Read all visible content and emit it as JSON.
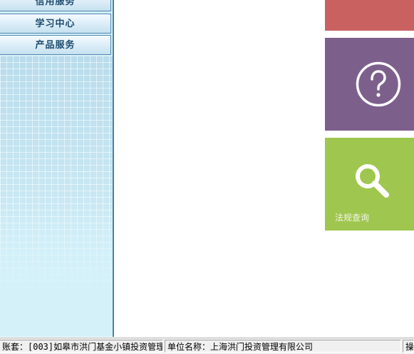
{
  "sidebar": {
    "items": [
      {
        "label": "信用服务"
      },
      {
        "label": "学习中心"
      },
      {
        "label": "产品服务"
      }
    ]
  },
  "tiles": {
    "help": {
      "icon": "question-icon"
    },
    "search": {
      "icon": "search-icon",
      "label": "法规查询"
    }
  },
  "statusbar": {
    "account": "账套：[003]如皋市洪门基金小镇投资管理",
    "unit": "单位名称：上海洪门投资管理有限公司",
    "operator": "操"
  },
  "colors": {
    "tile_red": "#c96161",
    "tile_purple": "#7d5f8c",
    "tile_green": "#9fc64e",
    "sidebar_bg": "#d4f1fa",
    "sidebar_border": "#4b7fa8"
  }
}
